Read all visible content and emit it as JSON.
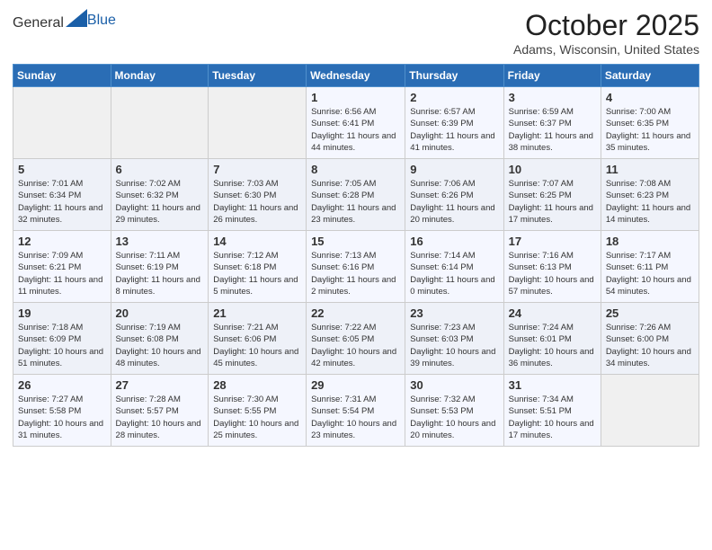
{
  "logo": {
    "general": "General",
    "blue": "Blue"
  },
  "title": "October 2025",
  "subtitle": "Adams, Wisconsin, United States",
  "days_header": [
    "Sunday",
    "Monday",
    "Tuesday",
    "Wednesday",
    "Thursday",
    "Friday",
    "Saturday"
  ],
  "weeks": [
    [
      {
        "day": "",
        "info": ""
      },
      {
        "day": "",
        "info": ""
      },
      {
        "day": "",
        "info": ""
      },
      {
        "day": "1",
        "info": "Sunrise: 6:56 AM\nSunset: 6:41 PM\nDaylight: 11 hours and 44 minutes."
      },
      {
        "day": "2",
        "info": "Sunrise: 6:57 AM\nSunset: 6:39 PM\nDaylight: 11 hours and 41 minutes."
      },
      {
        "day": "3",
        "info": "Sunrise: 6:59 AM\nSunset: 6:37 PM\nDaylight: 11 hours and 38 minutes."
      },
      {
        "day": "4",
        "info": "Sunrise: 7:00 AM\nSunset: 6:35 PM\nDaylight: 11 hours and 35 minutes."
      }
    ],
    [
      {
        "day": "5",
        "info": "Sunrise: 7:01 AM\nSunset: 6:34 PM\nDaylight: 11 hours and 32 minutes."
      },
      {
        "day": "6",
        "info": "Sunrise: 7:02 AM\nSunset: 6:32 PM\nDaylight: 11 hours and 29 minutes."
      },
      {
        "day": "7",
        "info": "Sunrise: 7:03 AM\nSunset: 6:30 PM\nDaylight: 11 hours and 26 minutes."
      },
      {
        "day": "8",
        "info": "Sunrise: 7:05 AM\nSunset: 6:28 PM\nDaylight: 11 hours and 23 minutes."
      },
      {
        "day": "9",
        "info": "Sunrise: 7:06 AM\nSunset: 6:26 PM\nDaylight: 11 hours and 20 minutes."
      },
      {
        "day": "10",
        "info": "Sunrise: 7:07 AM\nSunset: 6:25 PM\nDaylight: 11 hours and 17 minutes."
      },
      {
        "day": "11",
        "info": "Sunrise: 7:08 AM\nSunset: 6:23 PM\nDaylight: 11 hours and 14 minutes."
      }
    ],
    [
      {
        "day": "12",
        "info": "Sunrise: 7:09 AM\nSunset: 6:21 PM\nDaylight: 11 hours and 11 minutes."
      },
      {
        "day": "13",
        "info": "Sunrise: 7:11 AM\nSunset: 6:19 PM\nDaylight: 11 hours and 8 minutes."
      },
      {
        "day": "14",
        "info": "Sunrise: 7:12 AM\nSunset: 6:18 PM\nDaylight: 11 hours and 5 minutes."
      },
      {
        "day": "15",
        "info": "Sunrise: 7:13 AM\nSunset: 6:16 PM\nDaylight: 11 hours and 2 minutes."
      },
      {
        "day": "16",
        "info": "Sunrise: 7:14 AM\nSunset: 6:14 PM\nDaylight: 11 hours and 0 minutes."
      },
      {
        "day": "17",
        "info": "Sunrise: 7:16 AM\nSunset: 6:13 PM\nDaylight: 10 hours and 57 minutes."
      },
      {
        "day": "18",
        "info": "Sunrise: 7:17 AM\nSunset: 6:11 PM\nDaylight: 10 hours and 54 minutes."
      }
    ],
    [
      {
        "day": "19",
        "info": "Sunrise: 7:18 AM\nSunset: 6:09 PM\nDaylight: 10 hours and 51 minutes."
      },
      {
        "day": "20",
        "info": "Sunrise: 7:19 AM\nSunset: 6:08 PM\nDaylight: 10 hours and 48 minutes."
      },
      {
        "day": "21",
        "info": "Sunrise: 7:21 AM\nSunset: 6:06 PM\nDaylight: 10 hours and 45 minutes."
      },
      {
        "day": "22",
        "info": "Sunrise: 7:22 AM\nSunset: 6:05 PM\nDaylight: 10 hours and 42 minutes."
      },
      {
        "day": "23",
        "info": "Sunrise: 7:23 AM\nSunset: 6:03 PM\nDaylight: 10 hours and 39 minutes."
      },
      {
        "day": "24",
        "info": "Sunrise: 7:24 AM\nSunset: 6:01 PM\nDaylight: 10 hours and 36 minutes."
      },
      {
        "day": "25",
        "info": "Sunrise: 7:26 AM\nSunset: 6:00 PM\nDaylight: 10 hours and 34 minutes."
      }
    ],
    [
      {
        "day": "26",
        "info": "Sunrise: 7:27 AM\nSunset: 5:58 PM\nDaylight: 10 hours and 31 minutes."
      },
      {
        "day": "27",
        "info": "Sunrise: 7:28 AM\nSunset: 5:57 PM\nDaylight: 10 hours and 28 minutes."
      },
      {
        "day": "28",
        "info": "Sunrise: 7:30 AM\nSunset: 5:55 PM\nDaylight: 10 hours and 25 minutes."
      },
      {
        "day": "29",
        "info": "Sunrise: 7:31 AM\nSunset: 5:54 PM\nDaylight: 10 hours and 23 minutes."
      },
      {
        "day": "30",
        "info": "Sunrise: 7:32 AM\nSunset: 5:53 PM\nDaylight: 10 hours and 20 minutes."
      },
      {
        "day": "31",
        "info": "Sunrise: 7:34 AM\nSunset: 5:51 PM\nDaylight: 10 hours and 17 minutes."
      },
      {
        "day": "",
        "info": ""
      }
    ]
  ]
}
